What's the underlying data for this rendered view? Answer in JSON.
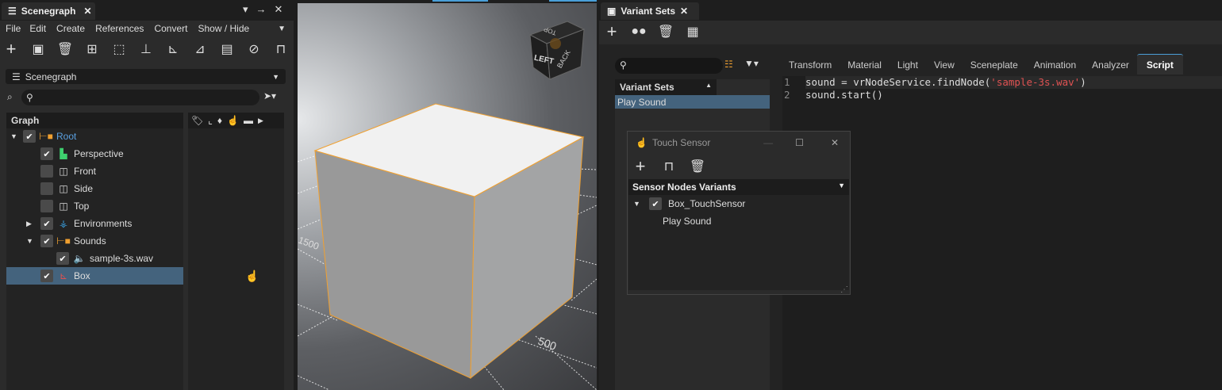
{
  "scenegraph": {
    "tab_title": "Scenegraph",
    "menu": [
      "File",
      "Edit",
      "Create",
      "References",
      "Convert",
      "Show / Hide"
    ],
    "view_select": "Scenegraph",
    "graph_header": "Graph",
    "tree": [
      {
        "label": "Root",
        "checked": true
      },
      {
        "label": "Perspective",
        "checked": true
      },
      {
        "label": "Front",
        "checked": false
      },
      {
        "label": "Side",
        "checked": false
      },
      {
        "label": "Top",
        "checked": false
      },
      {
        "label": "Environments",
        "checked": true
      },
      {
        "label": "Sounds",
        "checked": true
      },
      {
        "label": "sample-3s.wav",
        "checked": true
      },
      {
        "label": "Box",
        "checked": true,
        "selected": true
      }
    ]
  },
  "viewport": {
    "navcube": {
      "top": "TOP",
      "left": "LEFT",
      "back": "BACK"
    },
    "grid_labels": [
      "1500",
      "500"
    ]
  },
  "variants": {
    "tab_title": "Variant Sets",
    "list_header": "Variant Sets",
    "items": [
      "Play Sound"
    ],
    "tabs": [
      "Transform",
      "Material",
      "Light",
      "View",
      "Sceneplate",
      "Animation",
      "Analyzer",
      "Script"
    ],
    "active_tab": "Script",
    "code": {
      "line_numbers": [
        "1",
        "2"
      ],
      "line1_pre": "sound = vrNodeService.findNode(",
      "line1_str": "'sample-3s.wav'",
      "line1_post": ")",
      "line2": "sound.start()"
    }
  },
  "touch_sensor": {
    "title": "Touch Sensor",
    "header": "Sensor Nodes Variants",
    "node": "Box_TouchSensor",
    "child": "Play Sound"
  },
  "colors": {
    "accent": "#4a9fd8",
    "selection": "#44637d",
    "string": "#e05252",
    "orange": "#f0a030"
  }
}
